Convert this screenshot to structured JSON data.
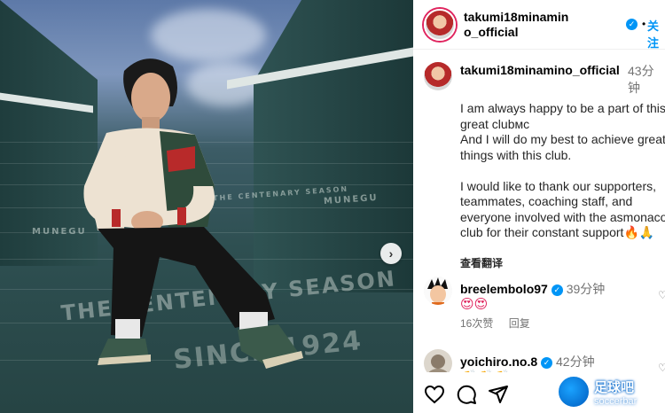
{
  "post": {
    "username": "takumi18minamino_official",
    "follow_label": "关注",
    "header_dot": "•",
    "caption": {
      "time": "43分钟",
      "text": "I am always happy to be a part of this great clubᴍᴄ\nAnd I will do my best to achieve great things with this club.\n\nI would like to thank our supporters, teammates, coaching staff, and everyone involved with the asmonaco club for their constant support",
      "emoji": "🔥🙏",
      "translate_label": "查看翻译"
    },
    "photo_text": {
      "stair_brand_1": "MUNEGU",
      "stair_brand_2": "MUNEGU",
      "stair_small": "THE CENTENARY SEASON",
      "big_line": "THE CENTENARY SEASON",
      "since": "SINCE 1924"
    },
    "next_glyph": "›"
  },
  "comments": [
    {
      "username": "breelembolo97",
      "time": "39分钟",
      "text": "😍😍",
      "likes": "16次赞",
      "reply": "回复"
    },
    {
      "username": "yoichiro.no.8",
      "time": "42分钟",
      "text": "👏👏👏",
      "likes": "",
      "reply": ""
    }
  ],
  "actions": [
    "heart-icon",
    "comment-icon",
    "share-icon"
  ],
  "watermark": {
    "cn": "足球吧",
    "en": "soccerbar"
  },
  "colors": {
    "accent": "#0095f6",
    "meta": "#737373"
  }
}
